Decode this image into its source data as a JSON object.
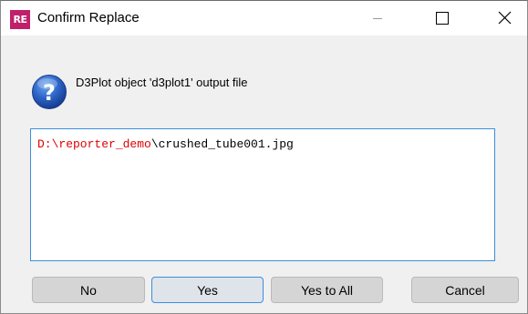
{
  "window": {
    "app_icon_text": "RE",
    "title": "Confirm Replace",
    "minimize_label": "minimize",
    "maximize_label": "maximize",
    "close_label": "close"
  },
  "icons": {
    "app": "reporter-app-icon",
    "message": "question-icon",
    "minimize": "minimize-icon",
    "maximize": "maximize-icon",
    "close": "close-icon"
  },
  "message": "D3Plot object 'd3plot1' output file",
  "path": {
    "highlight": "D:\\reporter_demo",
    "rest": "\\crushed_tube001.jpg"
  },
  "buttons": {
    "no": "No",
    "yes": "Yes",
    "yes_to_all": "Yes to All",
    "cancel": "Cancel"
  },
  "colors": {
    "app_icon_bg": "#c0206a",
    "path_highlight": "#e00000",
    "focus_border": "#3a8fde",
    "button_bg": "#d5d5d5"
  }
}
